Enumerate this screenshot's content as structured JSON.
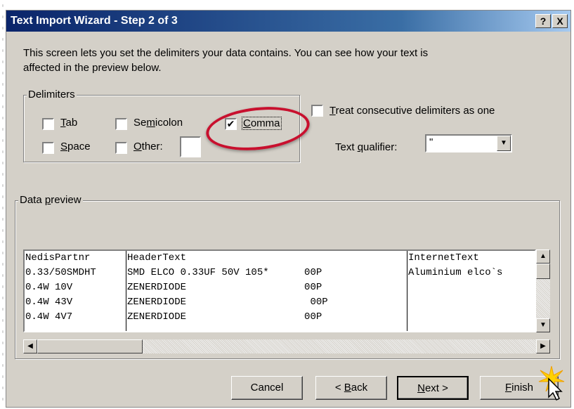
{
  "window": {
    "title": "Text Import Wizard - Step 2 of 3",
    "help_label": "?",
    "close_label": "X"
  },
  "description": "This screen lets you set the delimiters your data contains.  You can see how your text is affected in the preview below.",
  "delimiters": {
    "legend": "Delimiters",
    "tab": {
      "pre": "",
      "key": "T",
      "post": "ab",
      "checked": false
    },
    "semicolon": {
      "pre": "Se",
      "key": "m",
      "post": "icolon",
      "checked": false
    },
    "comma": {
      "pre": "",
      "key": "C",
      "post": "omma",
      "checked": true
    },
    "space": {
      "pre": "",
      "key": "S",
      "post": "pace",
      "checked": false
    },
    "other": {
      "pre": "",
      "key": "O",
      "post": "ther:",
      "checked": false,
      "value": ""
    }
  },
  "consecutive": {
    "pre": "",
    "key": "T",
    "post": "reat consecutive delimiters as one",
    "checked": false
  },
  "qualifier": {
    "pre": "Text ",
    "key": "q",
    "post": "ualifier:",
    "value": "\""
  },
  "preview": {
    "legend_pre": "Data ",
    "legend_key": "p",
    "legend_post": "review",
    "columns": [
      {
        "rows": [
          "NedisPartnr",
          "0.33/50SMDHT",
          "0.4W 10V",
          "0.4W 43V",
          "0.4W 4V7"
        ]
      },
      {
        "rows": [
          "HeaderText",
          "SMD ELCO 0.33UF 50V 105*      00P",
          "ZENERDIODE                    00P",
          "ZENERDIODE                     00P",
          "ZENERDIODE                    00P"
        ]
      },
      {
        "rows": [
          "InternetText",
          "Aluminium elco`s",
          "",
          "",
          ""
        ]
      }
    ]
  },
  "buttons": {
    "cancel": "Cancel",
    "back": {
      "pre": "< ",
      "key": "B",
      "post": "ack"
    },
    "next": {
      "pre": "",
      "key": "N",
      "post": "ext >"
    },
    "finish": {
      "pre": "",
      "key": "F",
      "post": "inish"
    }
  },
  "icons": {
    "check": "check-icon",
    "arrow_up": "arrow-up-icon",
    "arrow_down": "arrow-down-icon",
    "arrow_left": "arrow-left-icon",
    "arrow_right": "arrow-right-icon",
    "cursor": "mouse-pointer-icon"
  },
  "colors": {
    "title_start": "#0a246a",
    "title_end": "#a6caf0",
    "highlight": "#c8102e",
    "face": "#d4d0c8"
  }
}
